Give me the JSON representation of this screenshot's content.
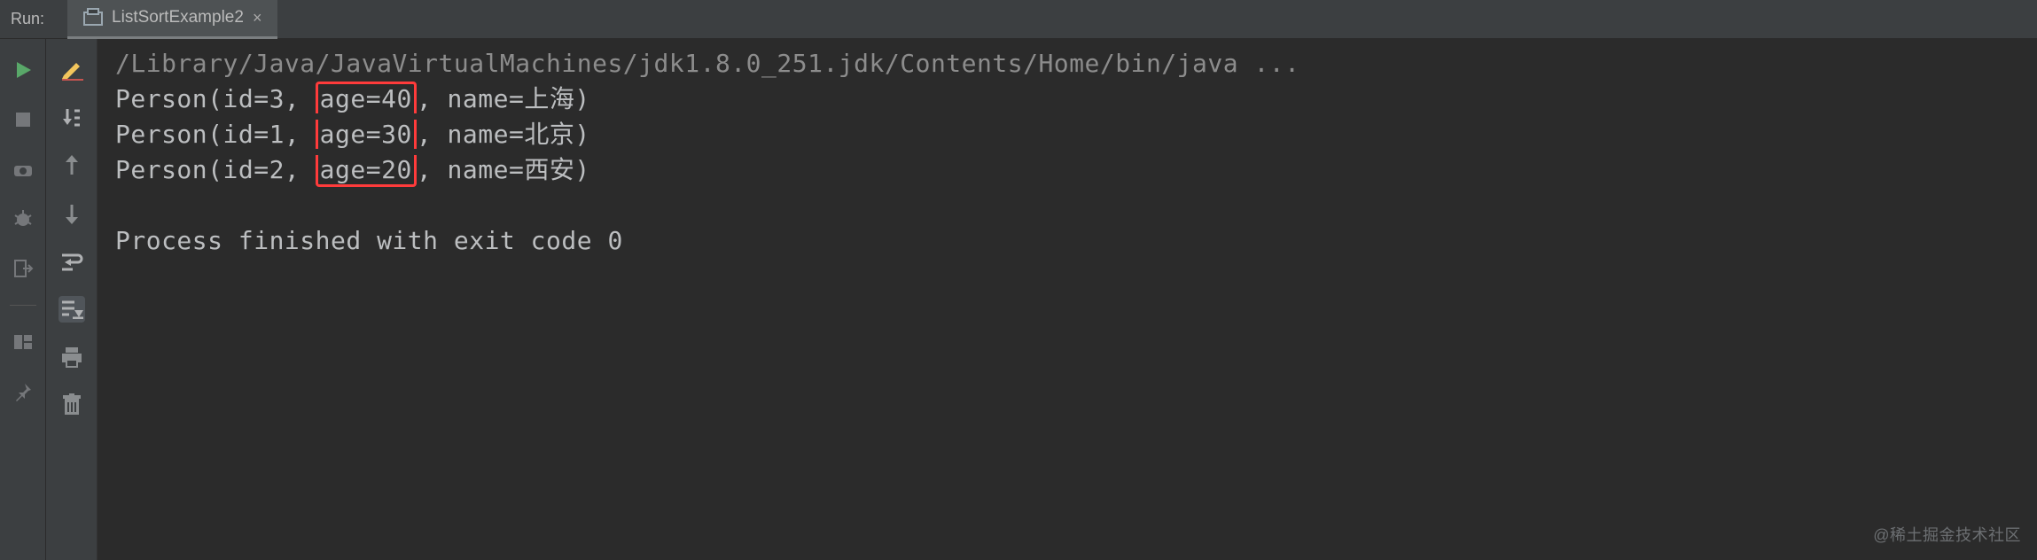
{
  "header": {
    "runLabel": "Run:",
    "tab": {
      "label": "ListSortExample2",
      "closeGlyph": "×"
    }
  },
  "console": {
    "cmd": "/Library/Java/JavaVirtualMachines/jdk1.8.0_251.jdk/Contents/Home/bin/java ...",
    "rows": [
      {
        "pre": "Person(id=3, ",
        "hl": "age=40",
        "post": ", name=上海)"
      },
      {
        "pre": "Person(id=1, ",
        "hl": "age=30",
        "post": ", name=北京)"
      },
      {
        "pre": "Person(id=2, ",
        "hl": "age=20",
        "post": ", name=西安)"
      }
    ],
    "exitLine": "Process finished with exit code 0"
  },
  "watermark": "@稀土掘金技术社区",
  "icons": {
    "left": [
      "run",
      "stop",
      "camera",
      "debug",
      "exit",
      "layout",
      "pin"
    ],
    "inner": [
      "marker",
      "step-down",
      "step-up",
      "step-over",
      "wrap",
      "scroll-end",
      "print",
      "trash"
    ]
  }
}
